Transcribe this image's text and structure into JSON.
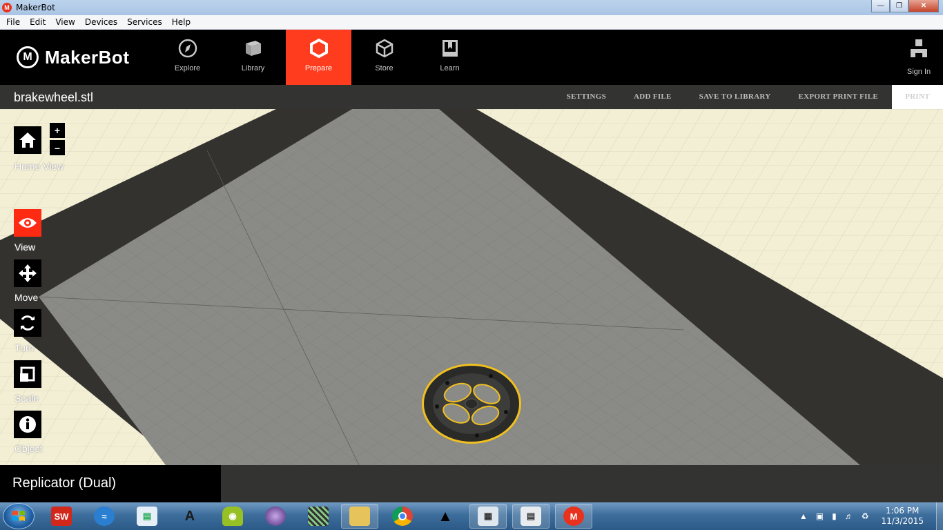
{
  "window": {
    "title": "MakerBot"
  },
  "menu": [
    "File",
    "Edit",
    "View",
    "Devices",
    "Services",
    "Help"
  ],
  "brand": {
    "name": "MakerBot"
  },
  "nav": {
    "tabs": [
      {
        "label": "Explore",
        "icon": "compass-icon"
      },
      {
        "label": "Library",
        "icon": "library-icon"
      },
      {
        "label": "Prepare",
        "icon": "prepare-icon",
        "active": true
      },
      {
        "label": "Store",
        "icon": "box-icon"
      },
      {
        "label": "Learn",
        "icon": "book-icon"
      }
    ],
    "sign_in": "Sign In"
  },
  "file": {
    "name": "brakewheel.stl",
    "actions": [
      "SETTINGS",
      "ADD FILE",
      "SAVE TO LIBRARY",
      "EXPORT PRINT FILE",
      "PRINT"
    ]
  },
  "tools": {
    "home_view": "Home View",
    "zoom_in": "+",
    "zoom_out": "–",
    "items": [
      {
        "label": "View",
        "icon": "eye-icon",
        "active": true
      },
      {
        "label": "Move",
        "icon": "move-icon"
      },
      {
        "label": "Turn",
        "icon": "rotate-icon"
      },
      {
        "label": "Scale",
        "icon": "scale-icon"
      },
      {
        "label": "Object",
        "icon": "info-icon"
      }
    ]
  },
  "printer": {
    "name": "Replicator (Dual)"
  },
  "taskbar": {
    "clock_time": "1:06 PM",
    "clock_date": "11/3/2015"
  },
  "colors": {
    "accent": "#ff3c1e",
    "build_plate": "#8a8a86",
    "plate_border": "#33322f",
    "floor": "#f3efd5",
    "selection": "#f0c020"
  }
}
